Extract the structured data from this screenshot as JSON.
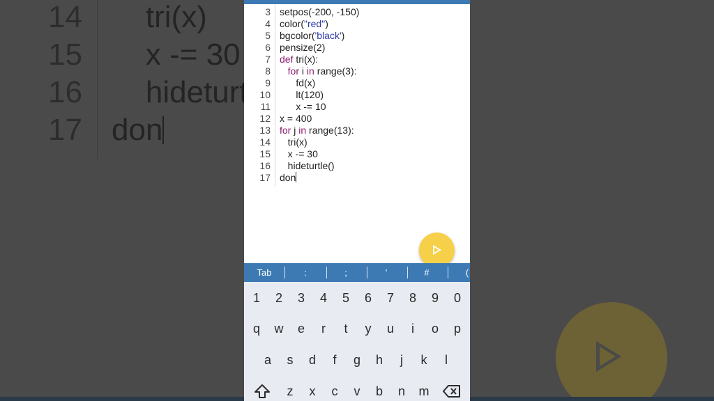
{
  "background": {
    "lines": [
      {
        "num": "14",
        "code": "    tri(x)"
      },
      {
        "num": "15",
        "code": "    x -= 30"
      },
      {
        "num": "16",
        "code": "    hideturtle()"
      },
      {
        "num": "17",
        "code": "don"
      }
    ]
  },
  "editor": {
    "lines": [
      {
        "num": "3",
        "code": "setpos(-200, -150)"
      },
      {
        "num": "4",
        "pre": "color(",
        "str": "\"red\"",
        "post": ")"
      },
      {
        "num": "5",
        "pre": "bgcolor(",
        "str": "'black'",
        "post": ")"
      },
      {
        "num": "6",
        "code": "pensize(2)"
      },
      {
        "num": "7",
        "kw": "def",
        "post": " tri(x):"
      },
      {
        "num": "8",
        "indent": "   ",
        "kw": "for",
        "mid": " i ",
        "kw2": "in",
        "post": " range(3):"
      },
      {
        "num": "9",
        "code": "      fd(x)"
      },
      {
        "num": "10",
        "code": "      lt(120)"
      },
      {
        "num": "11",
        "code": "      x -= 10"
      },
      {
        "num": "12",
        "code": "x = 400"
      },
      {
        "num": "13",
        "kw": "for",
        "mid": " j ",
        "kw2": "in",
        "post": " range(13):"
      },
      {
        "num": "14",
        "code": "   tri(x)"
      },
      {
        "num": "15",
        "code": "   x -= 30"
      },
      {
        "num": "16",
        "code": "   hideturtle()"
      },
      {
        "num": "17",
        "code": "don"
      }
    ]
  },
  "run_button": {
    "icon": "play-icon"
  },
  "extra_keys": [
    "Tab",
    ":",
    ";",
    "'",
    "#",
    "("
  ],
  "keyboard": {
    "row_numbers": [
      "1",
      "2",
      "3",
      "4",
      "5",
      "6",
      "7",
      "8",
      "9",
      "0"
    ],
    "row_top": [
      "q",
      "w",
      "e",
      "r",
      "t",
      "y",
      "u",
      "i",
      "o",
      "p"
    ],
    "row_middle": [
      "a",
      "s",
      "d",
      "f",
      "g",
      "h",
      "j",
      "k",
      "l"
    ],
    "row_bottom": [
      "z",
      "x",
      "c",
      "v",
      "b",
      "n",
      "m"
    ],
    "shift_icon": "shift-icon",
    "backspace_icon": "backspace-icon"
  },
  "colors": {
    "accent": "#3d7ab4",
    "run": "#f7d04a",
    "keyword": "#8a1c6e",
    "string": "#2e3aa3"
  }
}
